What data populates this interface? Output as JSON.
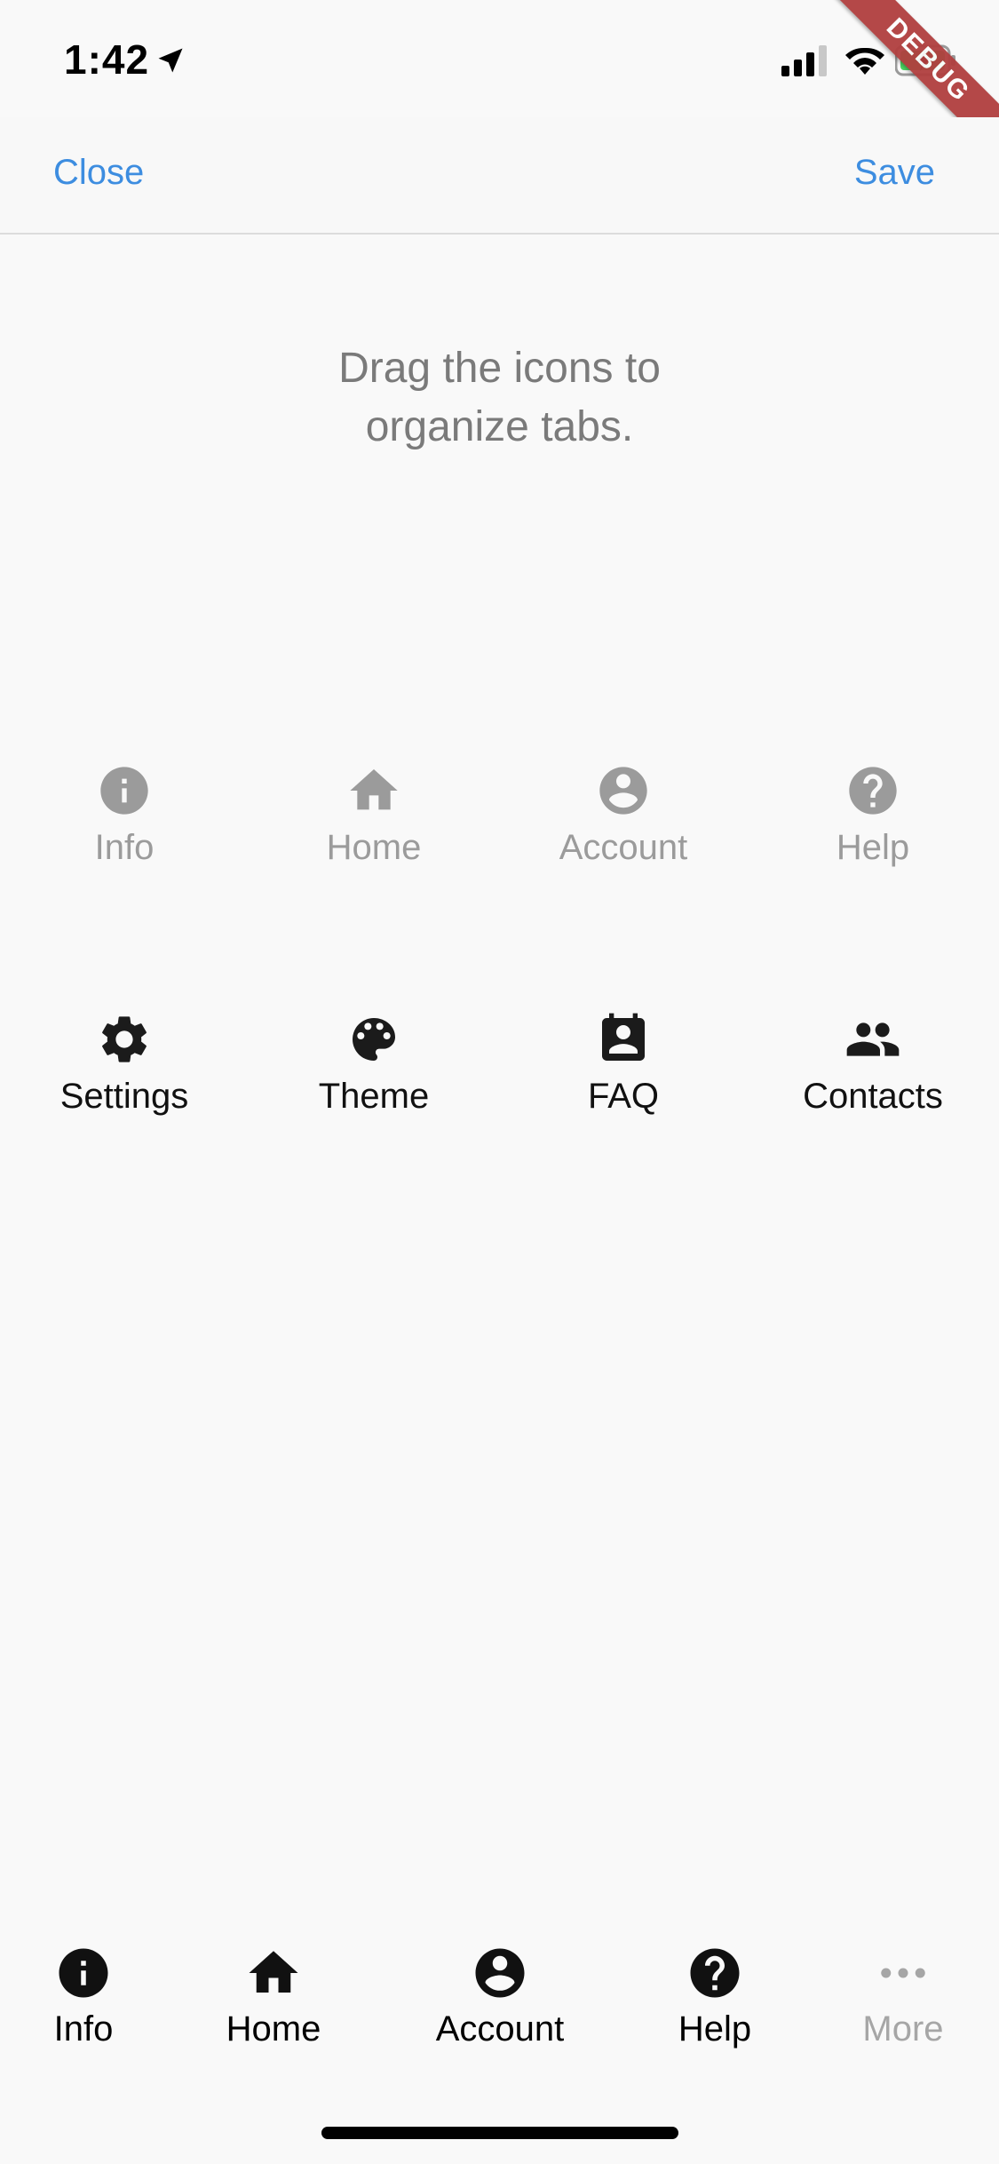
{
  "status_bar": {
    "time": "1:42",
    "icons": [
      "location-arrow-icon",
      "cellular-signal-icon",
      "wifi-icon",
      "battery-charging-icon"
    ]
  },
  "debug_banner": "DEBUG",
  "nav": {
    "close_label": "Close",
    "save_label": "Save",
    "accent_color": "#3d8de0"
  },
  "instruction": {
    "line1": "Drag the icons to",
    "line2": "organize tabs."
  },
  "grid": {
    "active_row": [
      {
        "label": "Info",
        "icon": "info-icon"
      },
      {
        "label": "Home",
        "icon": "home-icon"
      },
      {
        "label": "Account",
        "icon": "account-icon"
      },
      {
        "label": "Help",
        "icon": "help-icon"
      }
    ],
    "available_row": [
      {
        "label": "Settings",
        "icon": "settings-icon"
      },
      {
        "label": "Theme",
        "icon": "palette-icon"
      },
      {
        "label": "FAQ",
        "icon": "contact-card-icon"
      },
      {
        "label": "Contacts",
        "icon": "people-icon"
      }
    ]
  },
  "tab_bar": {
    "tabs": [
      {
        "label": "Info",
        "icon": "info-icon"
      },
      {
        "label": "Home",
        "icon": "home-icon"
      },
      {
        "label": "Account",
        "icon": "account-icon"
      },
      {
        "label": "Help",
        "icon": "help-icon"
      },
      {
        "label": "More",
        "icon": "more-dots-icon"
      }
    ],
    "inactive_color": "#a6a6a6"
  }
}
